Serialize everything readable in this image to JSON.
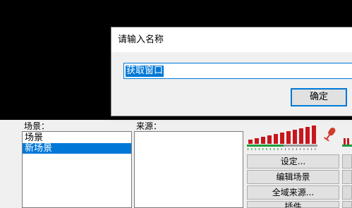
{
  "scenes": {
    "label": "场景：",
    "items": [
      {
        "label": "场景",
        "selected": false
      },
      {
        "label": "新场景",
        "selected": true
      }
    ]
  },
  "sources": {
    "label": "来源："
  },
  "side_buttons": [
    {
      "label": "设定..."
    },
    {
      "label": "编辑场景"
    },
    {
      "label": "全域来源..."
    },
    {
      "label": "插件"
    }
  ],
  "dialog": {
    "title": "请输入名称",
    "input_value": "获取窗口",
    "ok_label": "确定"
  },
  "colors": {
    "accent": "#0078d7",
    "meter_red": "#c8161d",
    "meter_green": "#1e9c3a",
    "mic_red": "#d23a2a"
  },
  "icons": [
    "microphone-icon"
  ]
}
